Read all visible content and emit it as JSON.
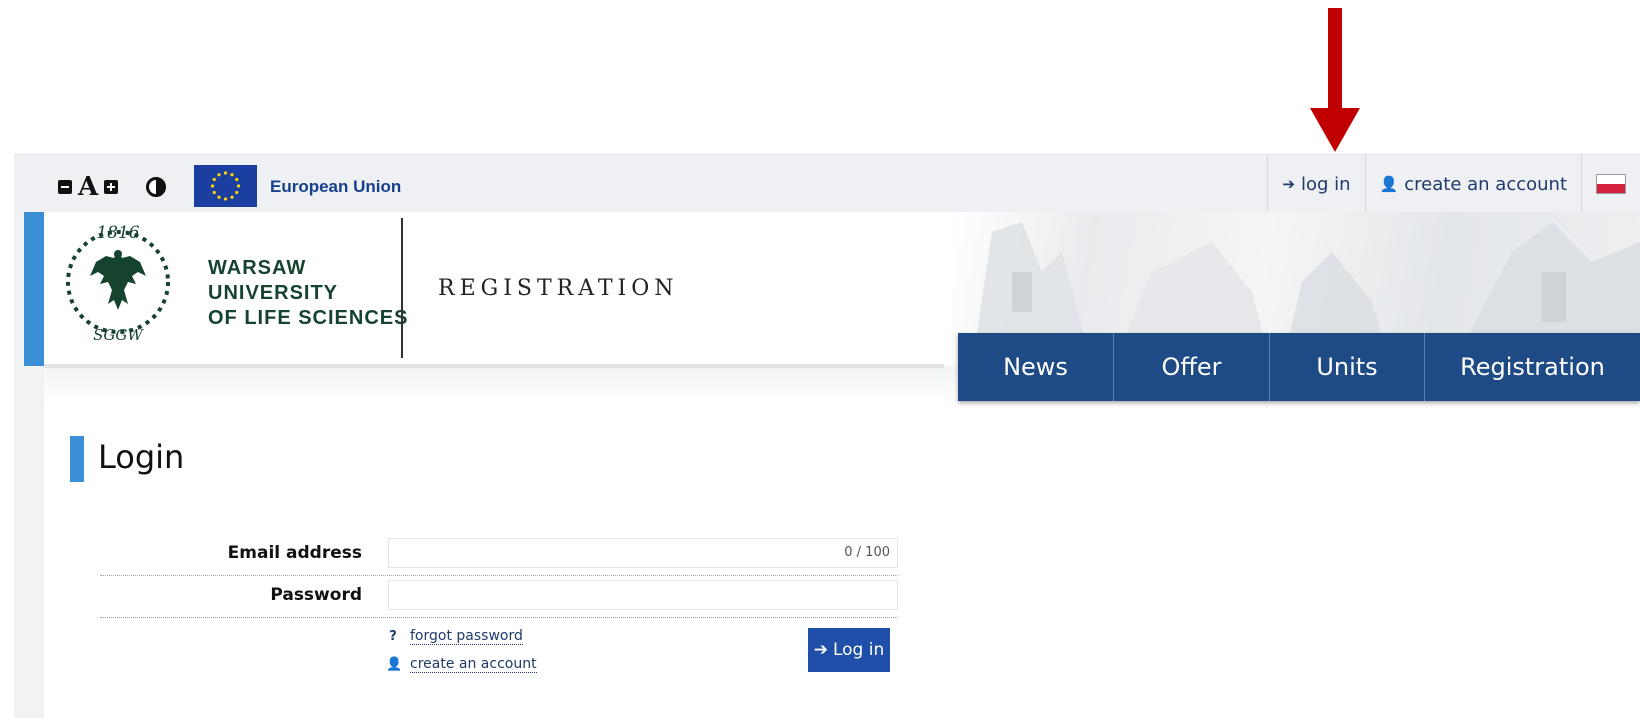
{
  "accessibility": {
    "decrease_font_icon": "minus-square-icon",
    "font_letter": "A",
    "increase_font_icon": "plus-square-icon",
    "contrast_icon": "contrast-icon"
  },
  "topbar": {
    "eu_label": "European Union",
    "login_label": "log in",
    "create_account_label": "create an account",
    "language_flag": "poland-flag-icon"
  },
  "header": {
    "crest_year": "1816",
    "crest_monogram": "SGGW",
    "university_lines": [
      "WARSAW",
      "UNIVERSITY",
      "OF LIFE SCIENCES"
    ],
    "section_title": "REGISTRATION"
  },
  "nav": {
    "items": [
      {
        "label": "News"
      },
      {
        "label": "Offer"
      },
      {
        "label": "Units"
      },
      {
        "label": "Registration"
      }
    ]
  },
  "main": {
    "page_title": "Login",
    "email_label": "Email address",
    "email_value": "",
    "email_counter": "0 / 100",
    "password_label": "Password",
    "password_value": "",
    "forgot_password_label": "forgot password",
    "create_account_label": "create an account",
    "login_button_label": "Log in"
  },
  "colors": {
    "accent_blue": "#3b8fd4",
    "nav_blue": "#1e4a86",
    "button_blue": "#1f4fa8",
    "crest_green": "#16432e",
    "annotation_red": "#c00000"
  }
}
